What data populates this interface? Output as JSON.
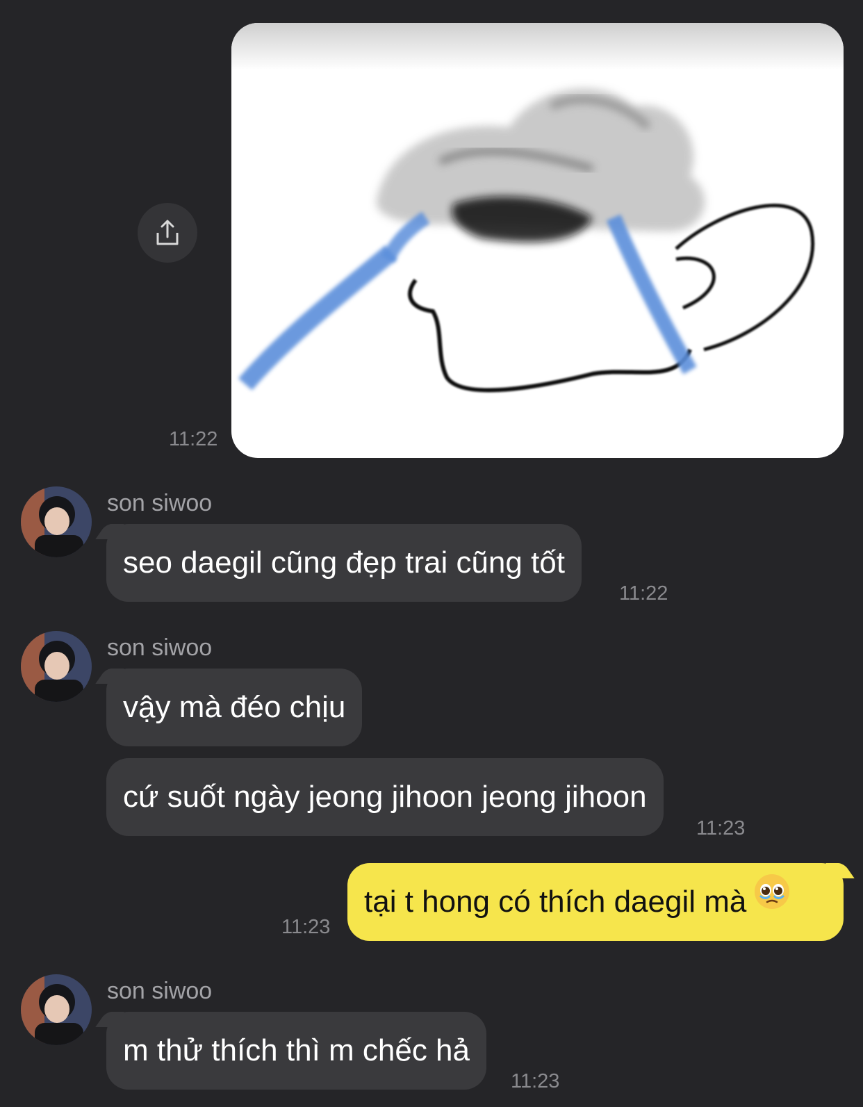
{
  "colors": {
    "background": "#252528",
    "incoming_bubble": "#3a3a3d",
    "outgoing_bubble": "#f6e54c",
    "timestamp": "#8a8a8e",
    "sender_name": "#a3a3a7"
  },
  "image_message": {
    "icon": "crying-cartoon-image",
    "share_icon": "share-icon",
    "time": "11:22"
  },
  "messages": [
    {
      "sender": "son siwoo",
      "avatar_icon": "avatar-photo",
      "bubbles": [
        "seo daegil cũng đẹp trai cũng tốt"
      ],
      "time": "11:22"
    },
    {
      "sender": "son siwoo",
      "avatar_icon": "avatar-photo",
      "bubbles": [
        "vậy mà đéo chịu",
        "cứ suốt ngày jeong jihoon jeong jihoon"
      ],
      "time": "11:23"
    },
    {
      "outgoing": true,
      "bubbles": [
        "tại t hong có thích daegil mà"
      ],
      "emoji_icon": "pleading-face-emoji",
      "time": "11:23"
    },
    {
      "sender": "son siwoo",
      "avatar_icon": "avatar-photo",
      "bubbles": [
        "m thử thích thì m chếc hả"
      ],
      "time": "11:23"
    }
  ]
}
